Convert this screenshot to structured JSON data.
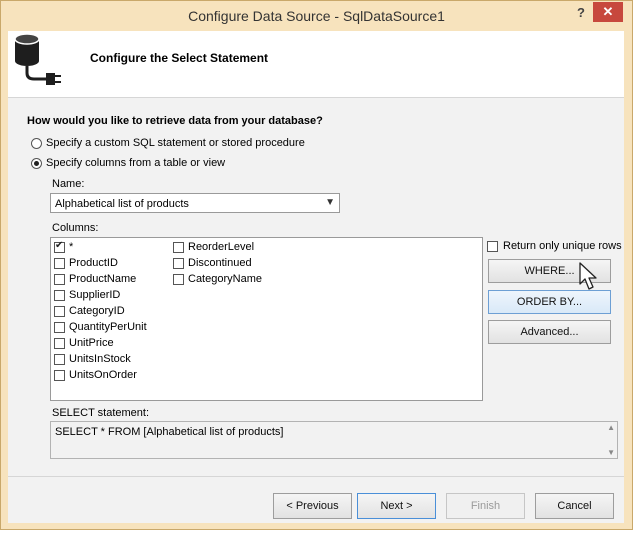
{
  "window": {
    "title": "Configure Data Source - SqlDataSource1",
    "help_label": "?",
    "close_label": "✕"
  },
  "header": {
    "title": "Configure the Select Statement",
    "icon": "database-connect-icon"
  },
  "question": "How would you like to retrieve data from your database?",
  "options": [
    {
      "label": "Specify a custom SQL statement or stored procedure",
      "selected": false
    },
    {
      "label": "Specify columns from a table or view",
      "selected": true
    }
  ],
  "name_field": {
    "label": "Name:",
    "value": "Alphabetical list of products"
  },
  "columns": {
    "label": "Columns:",
    "col1": [
      {
        "label": "*",
        "checked": true
      },
      {
        "label": "ProductID",
        "checked": false
      },
      {
        "label": "ProductName",
        "checked": false
      },
      {
        "label": "SupplierID",
        "checked": false
      },
      {
        "label": "CategoryID",
        "checked": false
      },
      {
        "label": "QuantityPerUnit",
        "checked": false
      },
      {
        "label": "UnitPrice",
        "checked": false
      },
      {
        "label": "UnitsInStock",
        "checked": false
      },
      {
        "label": "UnitsOnOrder",
        "checked": false
      }
    ],
    "col2": [
      {
        "label": "ReorderLevel",
        "checked": false
      },
      {
        "label": "Discontinued",
        "checked": false
      },
      {
        "label": "CategoryName",
        "checked": false
      }
    ]
  },
  "unique_rows": {
    "label": "Return only unique rows",
    "checked": false
  },
  "side_buttons": {
    "where": "WHERE...",
    "order_by": "ORDER BY...",
    "advanced": "Advanced..."
  },
  "select_statement": {
    "label": "SELECT statement:",
    "value": "SELECT * FROM [Alphabetical list of products]"
  },
  "footer": {
    "previous": "< Previous",
    "next": "Next >",
    "finish": "Finish",
    "cancel": "Cancel"
  },
  "colors": {
    "frame": "#f7e3bd",
    "close": "#c7483d",
    "focus_border": "#4a8fd8"
  }
}
